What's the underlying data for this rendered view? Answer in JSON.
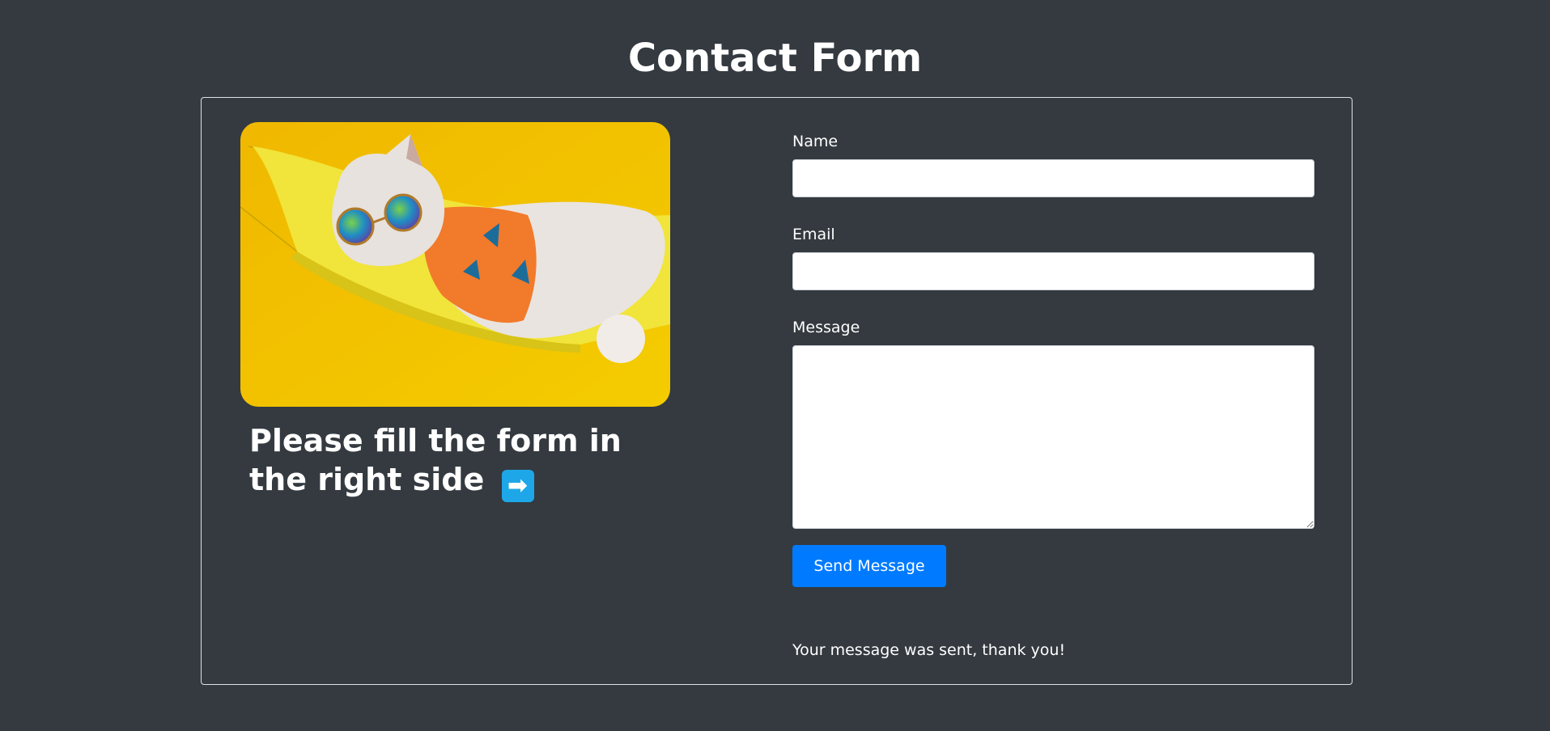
{
  "page": {
    "title": "Contact Form"
  },
  "left": {
    "image_subject": "cat in sunglasses and orange shirt lying in yellow hammock",
    "caption": "Please fill the form in the right side",
    "caption_icon": "right-arrow-emoji"
  },
  "form": {
    "name_label": "Name",
    "name_value": "",
    "email_label": "Email",
    "email_value": "",
    "message_label": "Message",
    "message_value": "",
    "submit_label": "Send Message",
    "status_message": "Your message was sent, thank you!"
  },
  "colors": {
    "background": "#343a40",
    "primary_button": "#007bff",
    "image_background": "#f2c200"
  }
}
